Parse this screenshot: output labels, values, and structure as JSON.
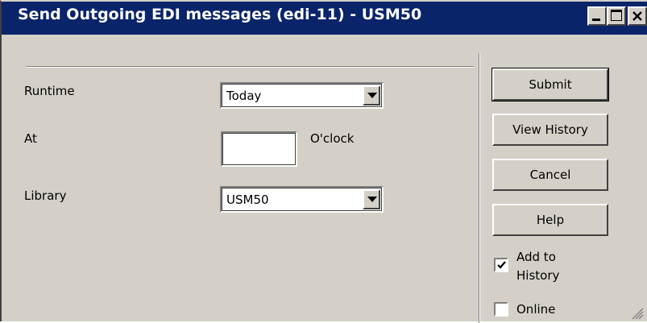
{
  "window": {
    "title": "Send Outgoing EDI messages (edi-11) - USM50"
  },
  "form": {
    "runtime_label": "Runtime",
    "runtime_value": "Today",
    "at_label": "At",
    "at_value": "",
    "oclock_label": "O'clock",
    "library_label": "Library",
    "library_value": "USM50"
  },
  "buttons": {
    "submit": "Submit",
    "view_history": "View History",
    "cancel": "Cancel",
    "help": "Help"
  },
  "options": {
    "add_to_history_label_line1": "Add to",
    "add_to_history_label_line2": "History",
    "add_to_history_checked": true,
    "online_label": "Online",
    "online_checked": false
  },
  "colors": {
    "titlebar": "#0a246a",
    "face": "#d4d0c8"
  }
}
